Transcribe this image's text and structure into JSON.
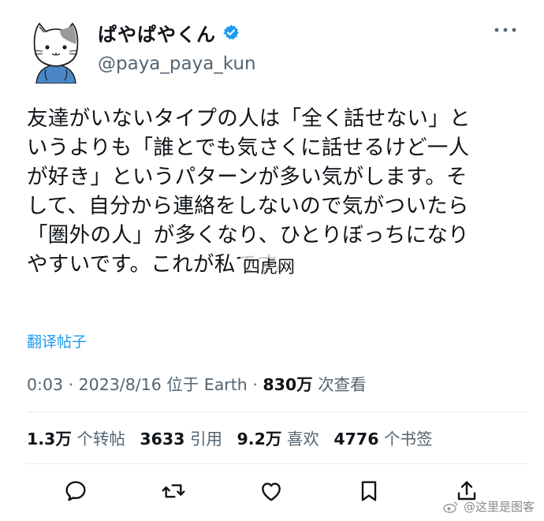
{
  "user": {
    "display_name": "ぱやぱやくん",
    "handle": "@paya_paya_kun",
    "verified_icon": "verified-badge-icon",
    "avatar_icon": "cat-avatar-icon"
  },
  "tweet": {
    "lines": [
      "友達がいないタイプの人は「全く話せない」と",
      "いうよりも「誰とでも気さくに話せるけど一人",
      "が好き」というパターンが多い気がします。そ",
      "して、自分から連絡をしないので気がついたら",
      "「圏外の人」が多くなり、ひとりぼっちになり",
      "やすいです。これが私です。"
    ]
  },
  "watermark_center": "四虎网",
  "translate_label": "翻译帖子",
  "meta": {
    "time": "0:03",
    "date": "2023/8/16",
    "location": "位于 Earth",
    "views_value": "830万",
    "views_label": "次查看"
  },
  "stats": {
    "retweets_value": "1.3万",
    "retweets_label": "个转帖",
    "quotes_value": "3633",
    "quotes_label": "引用",
    "likes_value": "9.2万",
    "likes_label": "喜欢",
    "bookmarks_value": "4776",
    "bookmarks_label": "个书签"
  },
  "actions": [
    "reply-icon",
    "retweet-icon",
    "like-icon",
    "bookmark-icon",
    "share-icon"
  ],
  "corner_watermark": "@这里是图客",
  "colors": {
    "text": "#0f1419",
    "secondary": "#536471",
    "accent": "#1d9bf0"
  }
}
